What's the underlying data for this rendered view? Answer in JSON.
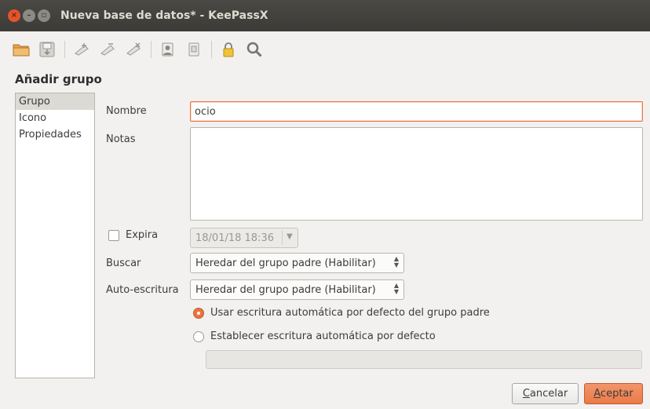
{
  "window": {
    "title": "Nueva base de datos* - KeePassX"
  },
  "toolbar": {
    "icons": [
      "open-database-icon",
      "save-database-icon",
      "add-entry-icon",
      "edit-entry-icon",
      "delete-entry-icon",
      "copy-username-icon",
      "copy-password-icon",
      "lock-icon",
      "search-icon"
    ]
  },
  "dialog": {
    "heading": "Añadir grupo",
    "categories": [
      "Grupo",
      "Icono",
      "Propiedades"
    ],
    "selected_category": "Grupo"
  },
  "form": {
    "name_label": "Nombre",
    "name_value": "ocio",
    "notes_label": "Notas",
    "notes_value": "",
    "expires_label": "Expira",
    "expires_checked": false,
    "expires_date": "18/01/18 18:36",
    "search_label": "Buscar",
    "search_value": "Heredar del grupo padre (Habilitar)",
    "autotype_label": "Auto-escritura",
    "autotype_value": "Heredar del grupo padre (Habilitar)",
    "radio_default_label": "Usar escritura automática por defecto del grupo padre",
    "radio_custom_label": "Establecer escritura automática por defecto",
    "selected_radio": "default",
    "custom_sequence_value": ""
  },
  "buttons": {
    "cancel_first": "C",
    "cancel_rest": "ancelar",
    "accept_first": "A",
    "accept_rest": "ceptar"
  },
  "colors": {
    "accent": "#e9743f",
    "titlebar": "#3c3b37"
  }
}
